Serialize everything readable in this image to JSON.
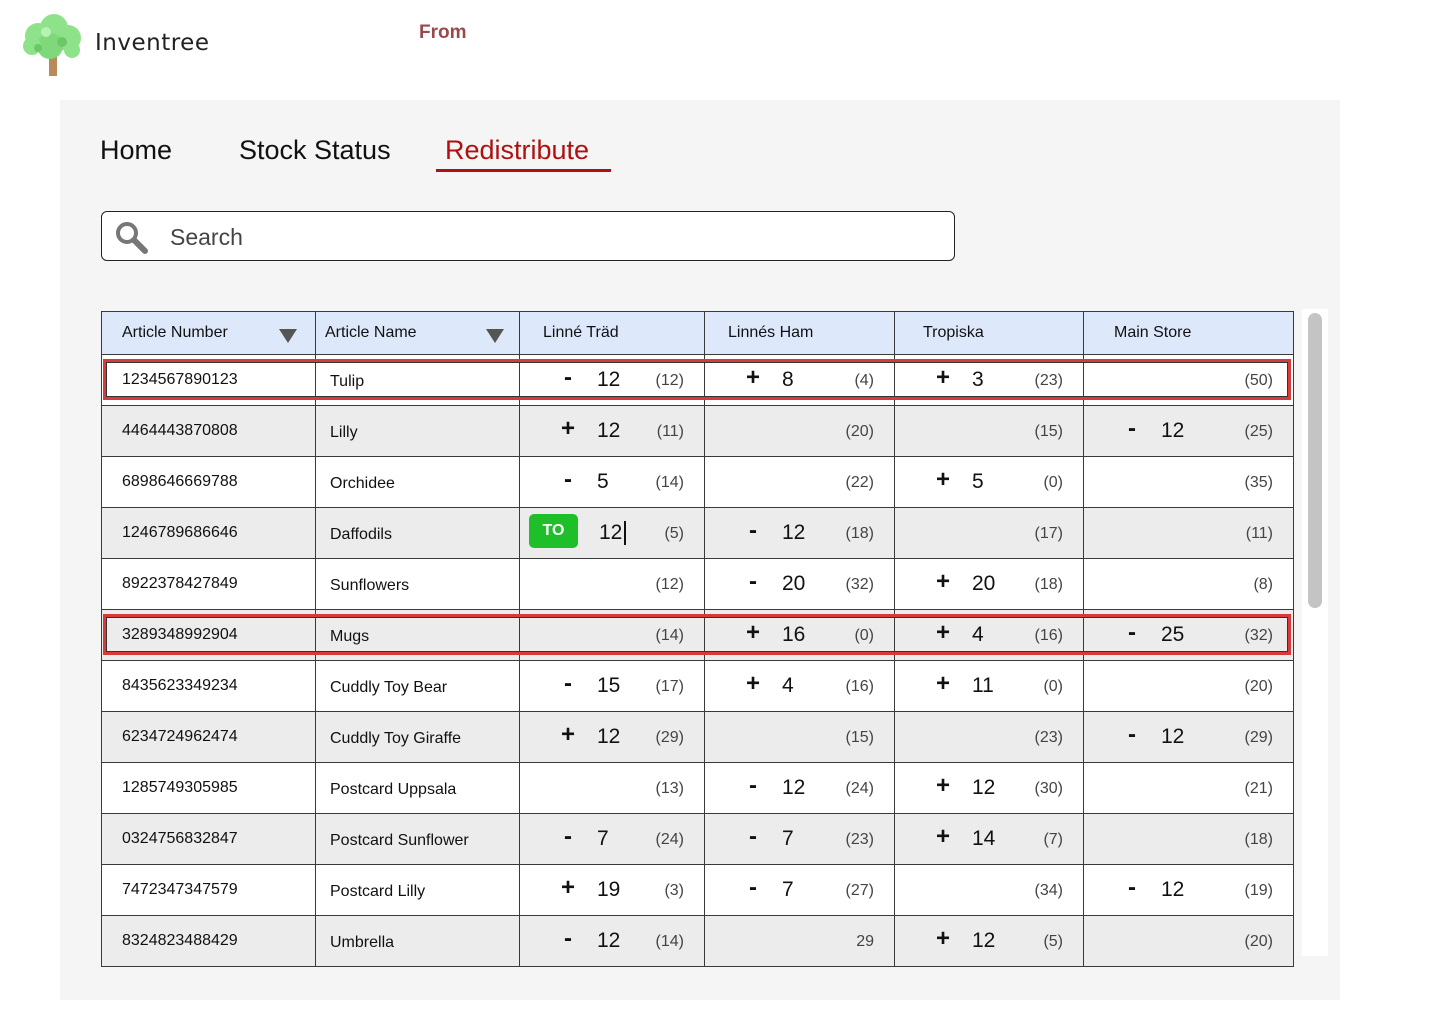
{
  "header": {
    "app_name": "Inventree",
    "logo_icon": "tree-icon",
    "from_label": "From"
  },
  "nav": {
    "tabs": [
      {
        "label": "Home",
        "active": false
      },
      {
        "label": "Stock Status",
        "active": false
      },
      {
        "label": "Redistribute",
        "active": true
      }
    ]
  },
  "search": {
    "placeholder": "Search",
    "value": "",
    "icon": "search-icon"
  },
  "colors": {
    "accent": "#b01010",
    "header_bg": "#dde9fb",
    "to_button": "#1fbf2a",
    "highlight": "#d83a3a"
  },
  "table": {
    "columns": [
      "Article Number",
      "Article Name",
      "Linné Träd",
      "Linnés Ham",
      "Tropiska",
      "Main Store"
    ],
    "rows": [
      {
        "article": "1234567890123",
        "name": "Tulip",
        "highlighted": true,
        "cells": [
          {
            "sign": "-",
            "qty": "12",
            "stock": "(12)"
          },
          {
            "sign": "+",
            "qty": "8",
            "stock": "(4)"
          },
          {
            "sign": "+",
            "qty": "3",
            "stock": "(23)"
          },
          {
            "sign": "",
            "qty": "",
            "stock": "(50)"
          }
        ]
      },
      {
        "article": "4464443870808",
        "name": "Lilly",
        "highlighted": false,
        "cells": [
          {
            "sign": "+",
            "qty": "12",
            "stock": "(11)"
          },
          {
            "sign": "",
            "qty": "",
            "stock": "(20)"
          },
          {
            "sign": "",
            "qty": "",
            "stock": "(15)"
          },
          {
            "sign": "-",
            "qty": "12",
            "stock": "(25)"
          }
        ]
      },
      {
        "article": "6898646669788",
        "name": "Orchidee",
        "highlighted": false,
        "cells": [
          {
            "sign": "-",
            "qty": "5",
            "stock": "(14)"
          },
          {
            "sign": "",
            "qty": "",
            "stock": "(22)"
          },
          {
            "sign": "+",
            "qty": "5",
            "stock": "(0)"
          },
          {
            "sign": "",
            "qty": "",
            "stock": "(35)"
          }
        ]
      },
      {
        "article": "1246789686646",
        "name": "Daffodils",
        "highlighted": false,
        "cells": [
          {
            "to_button": "TO",
            "qty": "12",
            "stock": "(5)"
          },
          {
            "sign": "-",
            "qty": "12",
            "stock": "(18)"
          },
          {
            "sign": "",
            "qty": "",
            "stock": "(17)"
          },
          {
            "sign": "",
            "qty": "",
            "stock": "(11)"
          }
        ]
      },
      {
        "article": "8922378427849",
        "name": "Sunflowers",
        "highlighted": false,
        "cells": [
          {
            "sign": "",
            "qty": "",
            "stock": "(12)"
          },
          {
            "sign": "-",
            "qty": "20",
            "stock": "(32)"
          },
          {
            "sign": "+",
            "qty": "20",
            "stock": "(18)"
          },
          {
            "sign": "",
            "qty": "",
            "stock": "(8)"
          }
        ]
      },
      {
        "article": "3289348992904",
        "name": "Mugs",
        "highlighted": true,
        "cells": [
          {
            "sign": "",
            "qty": "",
            "stock": "(14)"
          },
          {
            "sign": "+",
            "qty": "16",
            "stock": "(0)"
          },
          {
            "sign": "+",
            "qty": "4",
            "stock": "(16)"
          },
          {
            "sign": "-",
            "qty": "25",
            "stock": "(32)"
          }
        ]
      },
      {
        "article": "8435623349234",
        "name": "Cuddly Toy Bear",
        "highlighted": false,
        "cells": [
          {
            "sign": "-",
            "qty": "15",
            "stock": "(17)"
          },
          {
            "sign": "+",
            "qty": "4",
            "stock": "(16)"
          },
          {
            "sign": "+",
            "qty": "11",
            "stock": "(0)"
          },
          {
            "sign": "",
            "qty": "",
            "stock": "(20)"
          }
        ]
      },
      {
        "article": "6234724962474",
        "name": "Cuddly Toy Giraffe",
        "highlighted": false,
        "cells": [
          {
            "sign": "+",
            "qty": "12",
            "stock": "(29)"
          },
          {
            "sign": "",
            "qty": "",
            "stock": "(15)"
          },
          {
            "sign": "",
            "qty": "",
            "stock": "(23)"
          },
          {
            "sign": "-",
            "qty": "12",
            "stock": "(29)"
          }
        ]
      },
      {
        "article": "1285749305985",
        "name": "Postcard Uppsala",
        "highlighted": false,
        "cells": [
          {
            "sign": "",
            "qty": "",
            "stock": "(13)"
          },
          {
            "sign": "-",
            "qty": "12",
            "stock": "(24)"
          },
          {
            "sign": "+",
            "qty": "12",
            "stock": "(30)"
          },
          {
            "sign": "",
            "qty": "",
            "stock": "(21)"
          }
        ]
      },
      {
        "article": "0324756832847",
        "name": "Postcard Sunflower",
        "highlighted": false,
        "cells": [
          {
            "sign": "-",
            "qty": "7",
            "stock": "(24)"
          },
          {
            "sign": "-",
            "qty": "7",
            "stock": "(23)"
          },
          {
            "sign": "+",
            "qty": "14",
            "stock": "(7)"
          },
          {
            "sign": "",
            "qty": "",
            "stock": "(18)"
          }
        ]
      },
      {
        "article": "7472347347579",
        "name": "Postcard Lilly",
        "highlighted": false,
        "cells": [
          {
            "sign": "+",
            "qty": "19",
            "stock": "(3)"
          },
          {
            "sign": "-",
            "qty": "7",
            "stock": "(27)"
          },
          {
            "sign": "",
            "qty": "",
            "stock": "(34)"
          },
          {
            "sign": "-",
            "qty": "12",
            "stock": "(19)"
          }
        ]
      },
      {
        "article": "8324823488429",
        "name": "Umbrella",
        "highlighted": false,
        "cells": [
          {
            "sign": "-",
            "qty": "12",
            "stock": "(14)"
          },
          {
            "sign": "",
            "qty": "",
            "stock": "29"
          },
          {
            "sign": "+",
            "qty": "12",
            "stock": "(5)"
          },
          {
            "sign": "",
            "qty": "",
            "stock": "(20)"
          }
        ]
      }
    ]
  }
}
